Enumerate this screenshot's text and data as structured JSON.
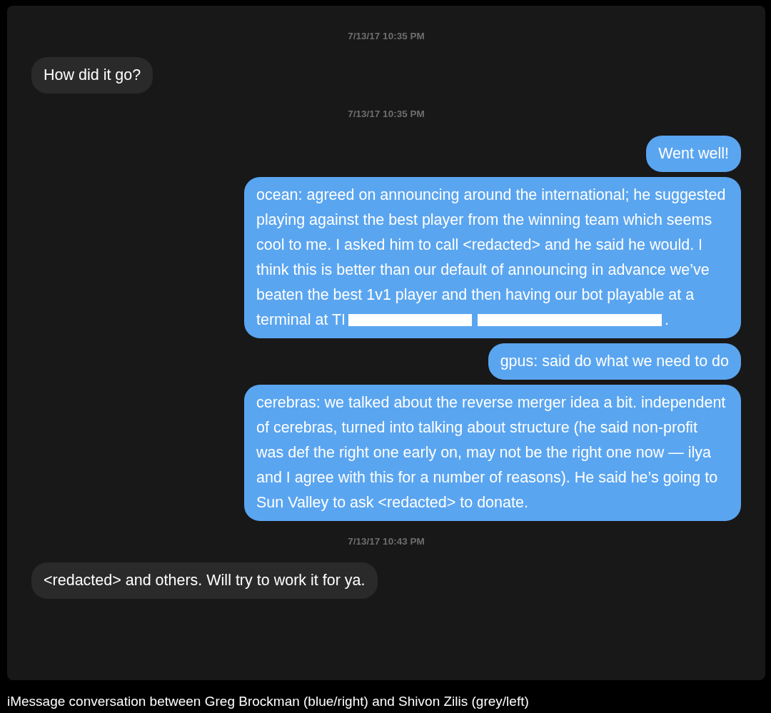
{
  "conversation": [
    {
      "kind": "timestamp",
      "text": "7/13/17 10:35 PM"
    },
    {
      "kind": "message",
      "sent": false,
      "parts": [
        {
          "kind": "text",
          "text": "How did it go?"
        }
      ]
    },
    {
      "kind": "timestamp",
      "text": "7/13/17 10:35 PM"
    },
    {
      "kind": "message",
      "sent": true,
      "parts": [
        {
          "kind": "text",
          "text": "Went well!"
        }
      ]
    },
    {
      "kind": "message",
      "sent": true,
      "parts": [
        {
          "kind": "text",
          "text": "ocean: agreed on announcing around the international; he suggested playing against the best player from the winning team which seems cool to me. I asked him to call <redacted> and he said he would. I think this is better than our default of announcing in advance we’ve beaten the best 1v1 player and then having our bot playable at a terminal at TI"
        },
        {
          "kind": "redaction"
        },
        {
          "kind": "redaction"
        },
        {
          "kind": "text",
          "text": "."
        }
      ]
    },
    {
      "kind": "message",
      "sent": true,
      "parts": [
        {
          "kind": "text",
          "text": "gpus: said do what we need to do"
        }
      ]
    },
    {
      "kind": "message",
      "sent": true,
      "parts": [
        {
          "kind": "text",
          "text": "cerebras: we talked about the reverse merger idea a bit. independent of cerebras, turned into talking about structure (he said non-profit was def the right one early on, may not be the right one now — ilya and I agree with this for a number of reasons). He said he’s going to Sun Valley to ask <redacted> to donate."
        }
      ]
    },
    {
      "kind": "timestamp",
      "text": "7/13/17 10:43 PM"
    },
    {
      "kind": "message",
      "sent": false,
      "parts": [
        {
          "kind": "text",
          "text": "<redacted> and others. Will try to work it for ya."
        }
      ]
    }
  ],
  "caption": "iMessage conversation between Greg Brockman (blue/right) and Shivon Zilis (grey/left)"
}
